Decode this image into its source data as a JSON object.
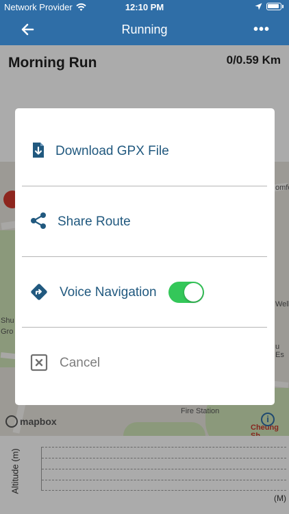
{
  "status_bar": {
    "carrier": "Network Provider",
    "time": "12:10 PM"
  },
  "nav": {
    "title": "Running",
    "more": "•••"
  },
  "run": {
    "title": "Morning Run",
    "distance": "0/0.59 Km"
  },
  "map": {
    "labels": [
      "Fire Station",
      "Cheung Sh",
      "Shu",
      "Gro",
      "Well",
      "u Es",
      "omfo"
    ],
    "attribution": "mapbox"
  },
  "altitude": {
    "axis_label": "Altitude (m)",
    "unit": "(M)"
  },
  "dialog": {
    "items": [
      {
        "label": "Download GPX File",
        "icon": "download-file-icon"
      },
      {
        "label": "Share Route",
        "icon": "share-icon"
      },
      {
        "label": "Voice Navigation",
        "icon": "directions-icon",
        "toggle_on": true
      },
      {
        "label": "Cancel",
        "icon": "close-box-icon"
      }
    ]
  },
  "colors": {
    "nav_bar": "#2f6ea7",
    "item_text": "#21597f",
    "toggle_on": "#34c759",
    "cancel_text": "#7d7d7d"
  }
}
